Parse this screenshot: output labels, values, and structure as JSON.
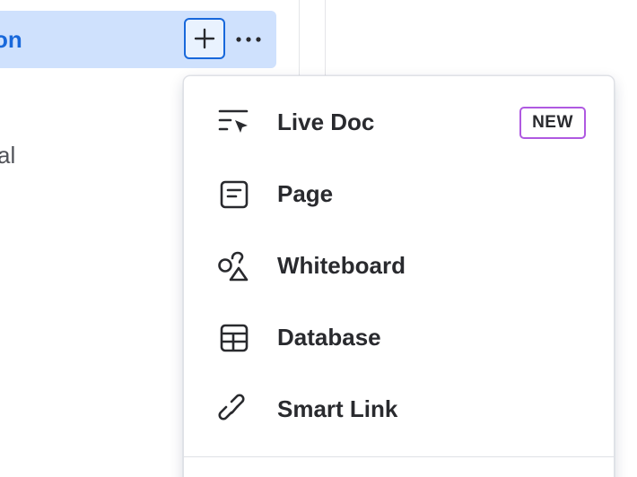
{
  "sidebar": {
    "selected_item_label": "on",
    "second_item_label": "al",
    "add_button_label": "+",
    "more_button_label": "···"
  },
  "menu": {
    "items": [
      {
        "label": "Live Doc",
        "icon": "live-doc-icon",
        "badge": "NEW"
      },
      {
        "label": "Page",
        "icon": "page-icon"
      },
      {
        "label": "Whiteboard",
        "icon": "whiteboard-icon"
      },
      {
        "label": "Database",
        "icon": "database-icon"
      },
      {
        "label": "Smart Link",
        "icon": "smart-link-icon"
      }
    ]
  },
  "colors": {
    "selected_bg": "#cfe1fd",
    "accent_blue": "#1868db",
    "badge_border": "#af59e1",
    "text": "#292a2e"
  }
}
